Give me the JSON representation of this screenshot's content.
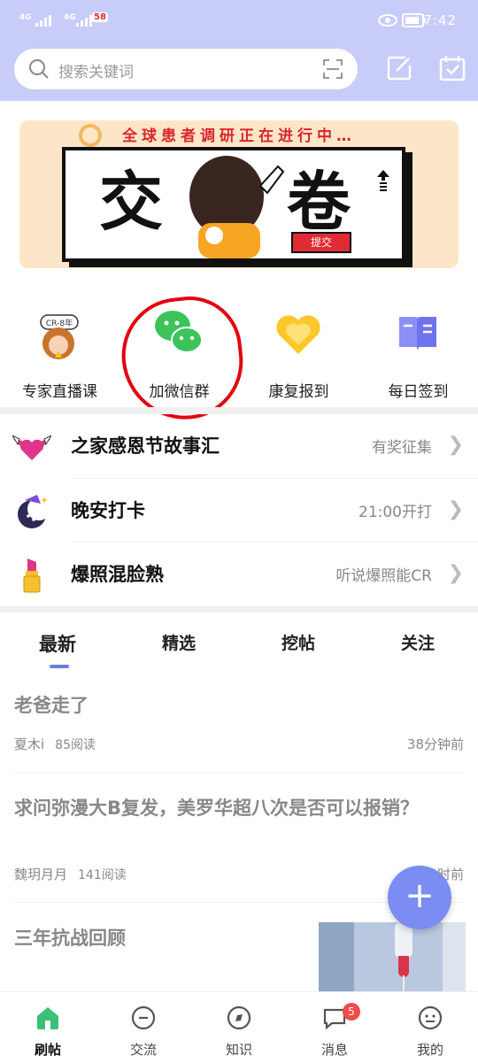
{
  "status_bar": {
    "signal_1": "4G",
    "signal_2": "4G",
    "app_badge": "58",
    "clock": "7:42"
  },
  "header": {
    "search_placeholder": "搜索关键词",
    "scan_icon": "scan-icon",
    "edit_icon": "edit-icon",
    "checkin_icon": "calendar-check-icon"
  },
  "banner": {
    "caption": "全球患者调研正在进行中…",
    "char_left": "交",
    "char_right": "卷",
    "button": "提交"
  },
  "quick_actions": [
    {
      "label": "专家直播课",
      "icon": "expert-avatar-icon"
    },
    {
      "label": "加微信群",
      "icon": "wechat-icon"
    },
    {
      "label": "康复报到",
      "icon": "heart-icon"
    },
    {
      "label": "每日签到",
      "icon": "book-icon"
    }
  ],
  "feature_rows": [
    {
      "title": "之家感恩节故事汇",
      "right": "有奖征集",
      "icon": "winged-heart-icon"
    },
    {
      "title": "晚安打卡",
      "right": "21:00开打",
      "icon": "moon-icon"
    },
    {
      "title": "爆照混脸熟",
      "right": "听说爆照能CR",
      "icon": "lipstick-icon"
    }
  ],
  "tabs": [
    {
      "label": "最新",
      "active": true
    },
    {
      "label": "精选",
      "active": false
    },
    {
      "label": "挖帖",
      "active": false
    },
    {
      "label": "关注",
      "active": false
    }
  ],
  "posts": [
    {
      "title": "老爸走了",
      "author": "夏木i",
      "reads": "85阅读",
      "time": "38分钟前"
    },
    {
      "title": "求问弥漫大B复发，美罗华超八次是否可以报销？",
      "author": "魏玥月月",
      "reads": "141阅读",
      "time": "时前"
    },
    {
      "title": "三年抗战回顾"
    }
  ],
  "fab_icon": "plus-icon",
  "bottom_nav": [
    {
      "label": "刷帖",
      "icon": "home-icon",
      "active": true
    },
    {
      "label": "交流",
      "icon": "chat-minus-icon"
    },
    {
      "label": "知识",
      "icon": "compass-icon"
    },
    {
      "label": "消息",
      "icon": "message-icon",
      "badge": "5"
    },
    {
      "label": "我的",
      "icon": "profile-icon"
    }
  ],
  "colors": {
    "header_bg": "#c7cdf8",
    "accent": "#7b8df2",
    "home_active": "#3bbf7a",
    "badge": "#f24a4a",
    "annotation_circle": "#e3000f"
  }
}
